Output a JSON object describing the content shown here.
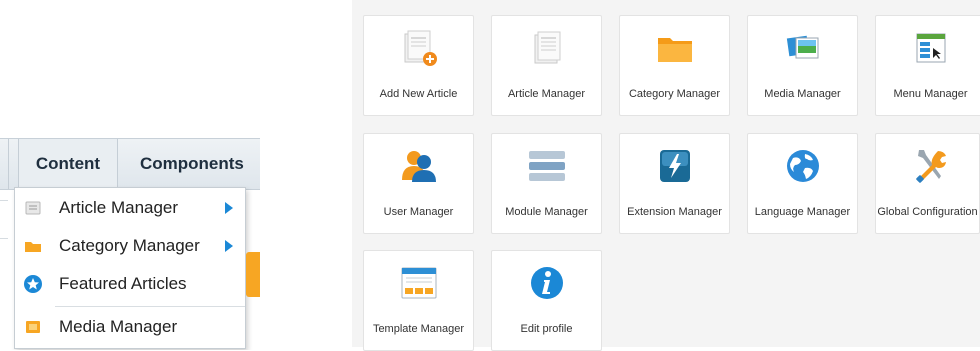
{
  "menubar": {
    "content_label": "Content",
    "components_label": "Components"
  },
  "dropdown": {
    "items": [
      {
        "label": "Article Manager",
        "has_submenu": true,
        "icon": "article-icon"
      },
      {
        "label": "Category Manager",
        "has_submenu": true,
        "icon": "folder-icon"
      },
      {
        "label": "Featured Articles",
        "has_submenu": false,
        "icon": "star-icon"
      },
      {
        "label": "Media Manager",
        "has_submenu": false,
        "icon": "media-icon"
      }
    ]
  },
  "quickicons": {
    "tiles": [
      {
        "label": "Add New Article",
        "icon": "add-article-icon"
      },
      {
        "label": "Article Manager",
        "icon": "article-manager-icon"
      },
      {
        "label": "Category Manager",
        "icon": "folder-icon"
      },
      {
        "label": "Media Manager",
        "icon": "media-icon"
      },
      {
        "label": "Menu Manager",
        "icon": "menu-icon"
      },
      {
        "label": "User Manager",
        "icon": "user-icon"
      },
      {
        "label": "Module Manager",
        "icon": "module-icon"
      },
      {
        "label": "Extension Manager",
        "icon": "extension-icon"
      },
      {
        "label": "Language Manager",
        "icon": "globe-icon"
      },
      {
        "label": "Global Configuration",
        "icon": "tools-icon"
      },
      {
        "label": "Template Manager",
        "icon": "template-icon"
      },
      {
        "label": "Edit profile",
        "icon": "info-icon"
      }
    ]
  },
  "colors": {
    "accent_blue": "#1b88d6",
    "folder_orange": "#f7a623"
  }
}
